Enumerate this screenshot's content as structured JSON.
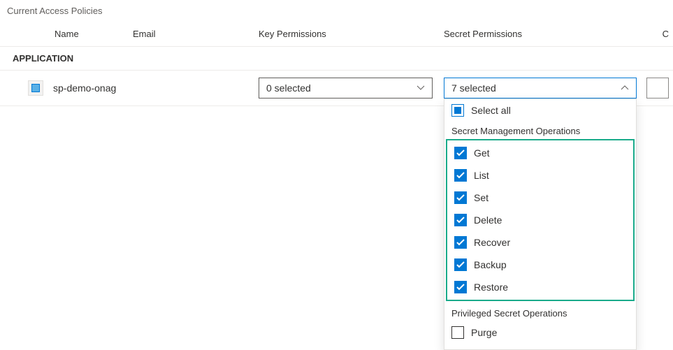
{
  "title": "Current Access Policies",
  "columns": {
    "name": "Name",
    "email": "Email",
    "key": "Key Permissions",
    "secret": "Secret Permissions",
    "extra": "C"
  },
  "section": "APPLICATION",
  "row": {
    "appName": "sp-demo-onag",
    "keySelected": "0 selected",
    "secretSelected": "7 selected"
  },
  "dropdown": {
    "selectAll": "Select all",
    "group1": "Secret Management Operations",
    "items1": {
      "get": "Get",
      "list": "List",
      "set": "Set",
      "delete": "Delete",
      "recover": "Recover",
      "backup": "Backup",
      "restore": "Restore"
    },
    "group2": "Privileged Secret Operations",
    "items2": {
      "purge": "Purge"
    }
  }
}
